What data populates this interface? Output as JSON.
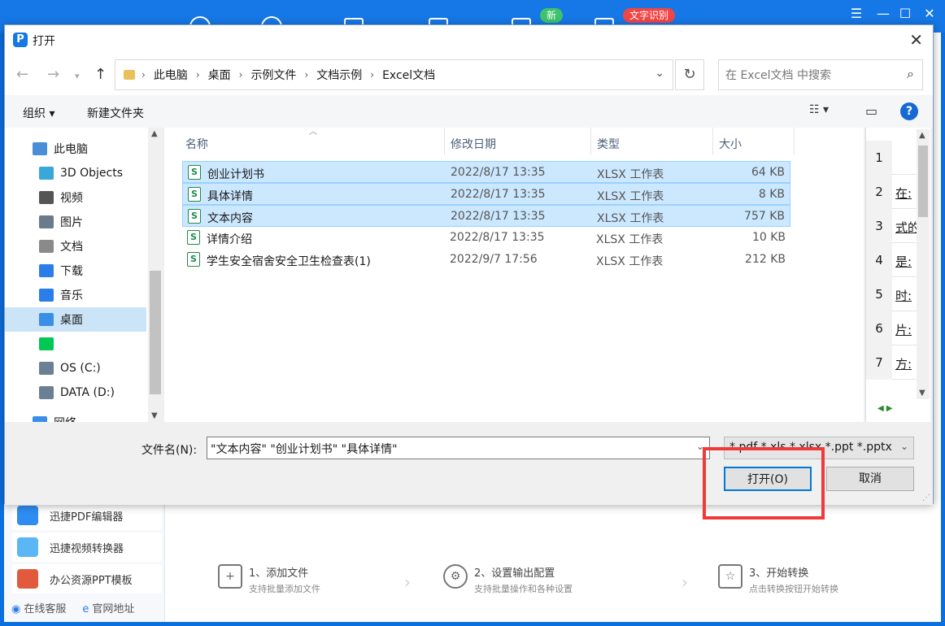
{
  "background_app": {
    "badge_new": "新",
    "badge_ocr": "文字识别",
    "window_controls": [
      "☰",
      "—",
      "☐",
      "✕"
    ],
    "tools": [
      {
        "label": "迅捷PDF编辑器",
        "color": "#2f8cf0"
      },
      {
        "label": "迅捷视频转换器",
        "color": "#5ab6f5"
      },
      {
        "label": "办公资源PPT模板",
        "color": "#e25a3e"
      }
    ],
    "footer": {
      "support": "在线客服",
      "website": "官网地址"
    },
    "steps": [
      {
        "title": "1、添加文件",
        "subtitle": "支持批量添加文件"
      },
      {
        "title": "2、设置输出配置",
        "subtitle": "支持批量操作和各种设置"
      },
      {
        "title": "3、开始转换",
        "subtitle": "点击转换按钮开始转换"
      }
    ]
  },
  "dialog": {
    "title": "打开",
    "breadcrumbs": [
      "此电脑",
      "桌面",
      "示例文件",
      "文档示例",
      "Excel文档"
    ],
    "search_placeholder": "在 Excel文档 中搜索",
    "toolbar": {
      "organize": "组织 ▾",
      "new_folder": "新建文件夹"
    },
    "nav": [
      {
        "label": "此电脑",
        "icon": "computer-icon",
        "color": "#4a8fd6"
      },
      {
        "label": "3D Objects",
        "icon": "cube-icon",
        "color": "#3aa7d9"
      },
      {
        "label": "视频",
        "icon": "video-icon",
        "color": "#555555"
      },
      {
        "label": "图片",
        "icon": "picture-icon",
        "color": "#6a7b8c"
      },
      {
        "label": "文档",
        "icon": "document-icon",
        "color": "#8a8a8a"
      },
      {
        "label": "下载",
        "icon": "download-icon",
        "color": "#2b7de9"
      },
      {
        "label": "音乐",
        "icon": "music-icon",
        "color": "#2b7de9"
      },
      {
        "label": "桌面",
        "icon": "desktop-icon",
        "color": "#3a8ee6",
        "selected": true
      },
      {
        "label": "",
        "icon": "iqiyi-icon",
        "color": "#00c853"
      },
      {
        "label": "OS (C:)",
        "icon": "drive-icon",
        "color": "#6b7f95"
      },
      {
        "label": "DATA (D:)",
        "icon": "drive-icon",
        "color": "#6b7f95"
      },
      {
        "label": "网络",
        "icon": "network-icon",
        "color": "#3a8ee6"
      }
    ],
    "columns": {
      "name": "名称",
      "modified": "修改日期",
      "type": "类型",
      "size": "大小"
    },
    "files": [
      {
        "name": "创业计划书",
        "modified": "2022/8/17 13:35",
        "type": "XLSX 工作表",
        "size": "64 KB",
        "selected": true
      },
      {
        "name": "具体详情",
        "modified": "2022/8/17 13:35",
        "type": "XLSX 工作表",
        "size": "8 KB",
        "selected": true
      },
      {
        "name": "文本内容",
        "modified": "2022/8/17 13:35",
        "type": "XLSX 工作表",
        "size": "757 KB",
        "selected": true
      },
      {
        "name": "详情介绍",
        "modified": "2022/8/17 13:35",
        "type": "XLSX 工作表",
        "size": "10 KB",
        "selected": false
      },
      {
        "name": "学生安全宿舍安全卫生检查表(1)",
        "modified": "2022/9/7 17:56",
        "type": "XLSX 工作表",
        "size": "212 KB",
        "selected": false
      }
    ],
    "preview_rows": [
      {
        "num": "1",
        "text": ""
      },
      {
        "num": "2",
        "text": "在:"
      },
      {
        "num": "3",
        "text": "式的"
      },
      {
        "num": "4",
        "text": "是:"
      },
      {
        "num": "5",
        "text": "时:"
      },
      {
        "num": "6",
        "text": "片:"
      },
      {
        "num": "7",
        "text": "方:"
      }
    ],
    "filename_label": "文件名(N):",
    "filename_value": "\"文本内容\" \"创业计划书\" \"具体详情\"",
    "filter_value": "*.pdf *.xls *.xlsx *.ppt *.pptx",
    "open_button": "打开(O)",
    "cancel_button": "取消"
  }
}
